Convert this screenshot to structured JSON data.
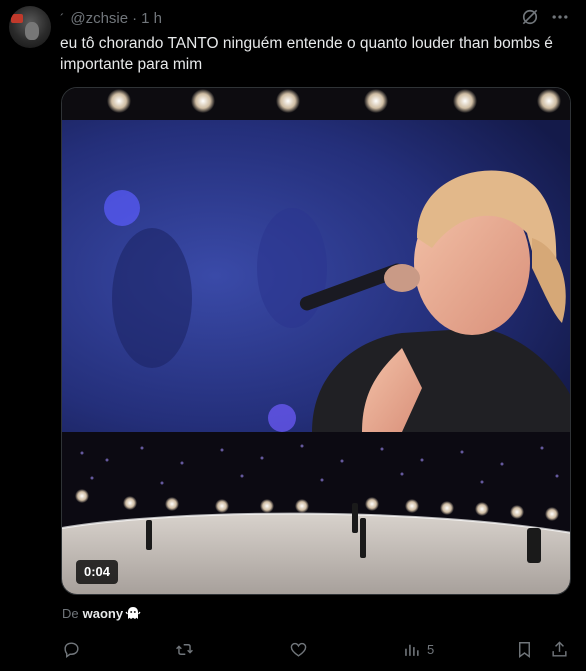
{
  "post": {
    "author_handle": "@zchsie",
    "name_mark": "´",
    "separator": "·",
    "timestamp": "1 h",
    "text": "eu tô chorando TANTO ninguém entende o quanto louder than bombs é importante para mim",
    "media": {
      "type": "video",
      "duration": "0:04"
    },
    "source": {
      "prefix": "De",
      "handle": "waony"
    },
    "actions": {
      "reply": {
        "icon": "reply-icon",
        "count": ""
      },
      "repost": {
        "icon": "repost-icon",
        "count": ""
      },
      "like": {
        "icon": "heart-icon",
        "count": ""
      },
      "views": {
        "icon": "views-icon",
        "count": "5"
      },
      "bookmark": {
        "icon": "bookmark-icon"
      },
      "share": {
        "icon": "share-icon"
      }
    }
  },
  "colors": {
    "background": "#000000",
    "text_primary": "#e7e9ea",
    "text_secondary": "#71767b",
    "border": "#2f3336"
  }
}
